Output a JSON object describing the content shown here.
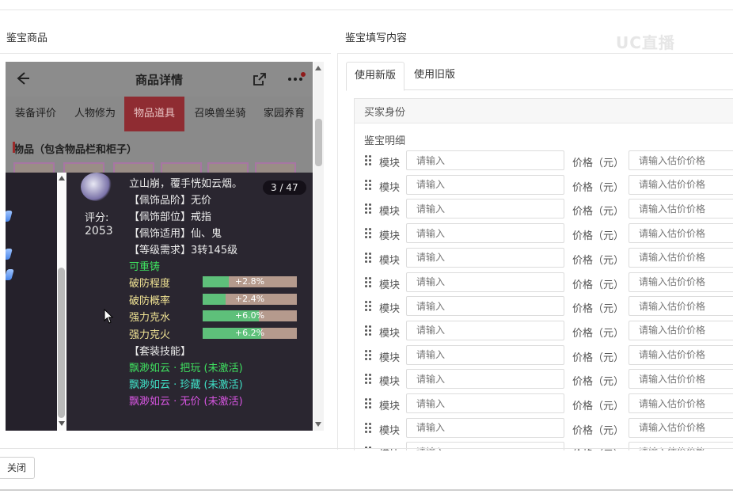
{
  "left_panel": {
    "title": "鉴宝商品"
  },
  "phone": {
    "title": "商品详情",
    "tabs": [
      "装备评价",
      "人物修为",
      "物品道具",
      "召唤兽坐骑",
      "家园养育"
    ],
    "active_tab": "物品道具",
    "section_title": "物品（包含物品栏和柜子）"
  },
  "popup": {
    "counter": "3 / 47",
    "score_label": "评分:",
    "score_value": "2053",
    "lines": [
      {
        "text": "立山崩，覆手恍如云烟。",
        "color": "white"
      },
      {
        "text": "【佩饰品阶】无价",
        "color": "white"
      },
      {
        "text": "【佩饰部位】戒指",
        "color": "white"
      },
      {
        "text": "【佩饰适用】仙、鬼",
        "color": "white"
      },
      {
        "text": "【等级需求】3转145级",
        "color": "white"
      },
      {
        "text": "可重铸",
        "color": "green"
      }
    ],
    "stats": [
      {
        "label": "破防程度",
        "value": "+2.8%",
        "fill": 0.28
      },
      {
        "label": "破防概率",
        "value": "+2.4%",
        "fill": 0.24
      },
      {
        "label": "强力克水",
        "value": "+6.0%",
        "fill": 0.6
      },
      {
        "label": "强力克火",
        "value": "+6.2%",
        "fill": 0.62
      }
    ],
    "set_title": "【套装技能】",
    "set_skills": [
      {
        "text": "飘渺如云 · 把玩 (未激活)",
        "color": "green"
      },
      {
        "text": "飘渺如云 · 珍藏 (未激活)",
        "color": "cyan"
      },
      {
        "text": "飘渺如云 · 无价 (未激活)",
        "color": "magenta"
      }
    ]
  },
  "right_panel": {
    "title": "鉴宝填写内容",
    "tabs": [
      "使用新版",
      "使用旧版"
    ],
    "active_tab": "使用新版",
    "buyer_label": "买家身份",
    "detail_label": "鉴宝明细",
    "row_label": "模块",
    "row_placeholder": "请输入",
    "price_label": "价格（元）",
    "price_placeholder": "请输入估价价格",
    "row_count": 13
  },
  "footer": {
    "close_label": "关闭"
  },
  "watermark": "UC直播",
  "colors": {
    "active_tab_bg": "#8f2c32",
    "popup_bg": "#2a2630",
    "stat_bar": "#5ec07a",
    "green_text": "#3ee05f"
  }
}
